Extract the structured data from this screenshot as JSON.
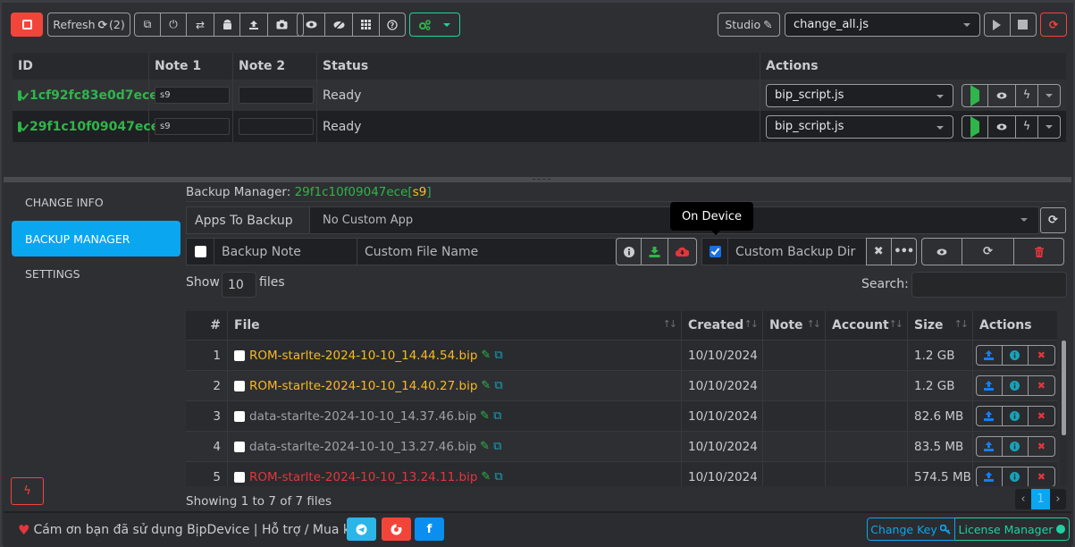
{
  "toolbar": {
    "stop_label": "",
    "refresh_label": "Refresh",
    "refresh_count": "(2)",
    "device_group_icons": [
      "copy-icon",
      "power-icon",
      "retweet-icon",
      "android-icon",
      "upload-icon",
      "camera-icon"
    ],
    "view_group_icons": [
      "eye-icon",
      "eye-slash-icon",
      "grid-icon",
      "help-icon"
    ],
    "settings_group_icon": "cogs-icon",
    "studio_label": "Studio",
    "script_select": "change_all.js"
  },
  "devices": {
    "headers": [
      "ID",
      "Note 1",
      "Note 2",
      "Status",
      "Actions"
    ],
    "rows": [
      {
        "id": "1cf92fc83e0d7ece",
        "note1": "s9",
        "note2": "",
        "status": "Ready",
        "script": "bip_script.js"
      },
      {
        "id": "29f1c10f09047ece",
        "note1": "s9",
        "note2": "",
        "status": "Ready",
        "script": "bip_script.js"
      }
    ]
  },
  "sidebar": {
    "items": [
      {
        "label": "CHANGE INFO",
        "active": false
      },
      {
        "label": "BACKUP MANAGER",
        "active": true
      },
      {
        "label": "SETTINGS",
        "active": false
      }
    ]
  },
  "backup": {
    "title_prefix": "Backup Manager:",
    "device_id": "29f1c10f09047ece",
    "note_open": "[",
    "note": "s9",
    "note_close": "]",
    "apps_label": "Apps To Backup",
    "apps_value": "No Custom App",
    "backup_note_placeholder": "Backup Note",
    "custom_file_placeholder": "Custom File Name",
    "custom_dir_placeholder": "Custom Backup Dir",
    "on_device_tooltip": "On Device",
    "on_device_checked": true,
    "show_label": "Show",
    "show_value": "10",
    "files_label": "files",
    "search_label": "Search:",
    "search_value": ""
  },
  "files": {
    "headers": [
      "#",
      "File",
      "Created",
      "Note",
      "Account",
      "Size",
      "Actions"
    ],
    "rows": [
      {
        "num": "1",
        "name": "ROM-starlte-2024-10-10_14.44.54.bip",
        "color": "yellow",
        "created": "10/10/2024",
        "note": "",
        "account": "",
        "size": "1.2 GB"
      },
      {
        "num": "2",
        "name": "ROM-starlte-2024-10-10_14.40.27.bip",
        "color": "yellow",
        "created": "10/10/2024",
        "note": "",
        "account": "",
        "size": "1.2 GB"
      },
      {
        "num": "3",
        "name": "data-starlte-2024-10-10_14.37.46.bip",
        "color": "gray",
        "created": "10/10/2024",
        "note": "",
        "account": "",
        "size": "82.6 MB"
      },
      {
        "num": "4",
        "name": "data-starlte-2024-10-10_13.27.46.bip",
        "color": "gray",
        "created": "10/10/2024",
        "note": "",
        "account": "",
        "size": "83.5 MB"
      },
      {
        "num": "5",
        "name": "ROM-starlte-2024-10-10_13.24.11.bip",
        "color": "red",
        "created": "10/10/2024",
        "note": "",
        "account": "",
        "size": "574.5 MB"
      }
    ],
    "showing": "Showing 1 to 7 of 7 files",
    "pager": {
      "prev": "‹",
      "current": "1",
      "next": "›"
    }
  },
  "footer": {
    "thanks": "Cám ơn bạn đã sử dụng BịpDevice | Hỗ trợ / Mua key",
    "social": [
      "telegram-icon",
      "chrome-icon",
      "facebook-icon"
    ],
    "change_key": "Change Key",
    "license_manager": "License Manager"
  },
  "colors": {
    "accent_blue": "#0aa6f0",
    "accent_green": "#1fd1a0",
    "ok_green": "#2fb54a",
    "danger_red": "#f2453a",
    "warning_yellow": "#f7b924"
  }
}
